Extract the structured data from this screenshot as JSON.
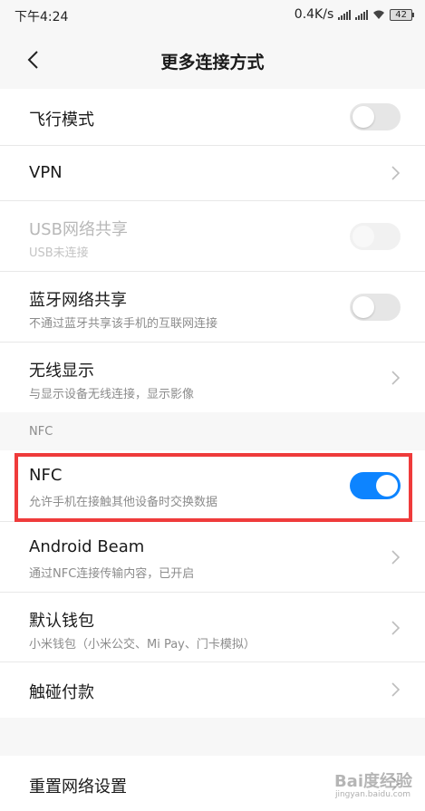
{
  "status_bar": {
    "time": "下午4:24",
    "network_speed": "0.4K/s",
    "battery": "42",
    "icons": [
      "signal-icon",
      "signal-icon",
      "wifi-icon",
      "battery-icon"
    ]
  },
  "header": {
    "title": "更多连接方式",
    "back_icon": "chevron-left-icon"
  },
  "group1": [
    {
      "title": "飞行模式",
      "control": "toggle",
      "state": "off"
    },
    {
      "title": "VPN",
      "control": "chevron"
    },
    {
      "title": "USB网络共享",
      "subtitle": "USB未连接",
      "control": "toggle",
      "state": "disabled"
    },
    {
      "title": "蓝牙网络共享",
      "subtitle": "不通过蓝牙共享该手机的互联网连接",
      "control": "toggle",
      "state": "off"
    },
    {
      "title": "无线显示",
      "subtitle": "与显示设备无线连接，显示影像",
      "control": "chevron"
    }
  ],
  "nfc_section": {
    "label": "NFC"
  },
  "group2": [
    {
      "title": "NFC",
      "subtitle": "允许手机在接触其他设备时交换数据",
      "control": "toggle",
      "state": "on"
    },
    {
      "title": "Android Beam",
      "subtitle": "通过NFC连接传输内容，已开启",
      "control": "chevron"
    },
    {
      "title": "默认钱包",
      "subtitle": "小米钱包（小米公交、Mi Pay、门卡模拟）",
      "control": "chevron"
    },
    {
      "title": "触碰付款",
      "control": "chevron"
    }
  ],
  "group3": [
    {
      "title": "重置网络设置",
      "control": "chevron"
    }
  ],
  "colors": {
    "accent": "#0d84ff",
    "highlight_border": "#ef3b3b",
    "background": "#f7f7f7"
  },
  "watermark": {
    "text": "Bai度经验",
    "url": "jingyan.baidu.com"
  }
}
